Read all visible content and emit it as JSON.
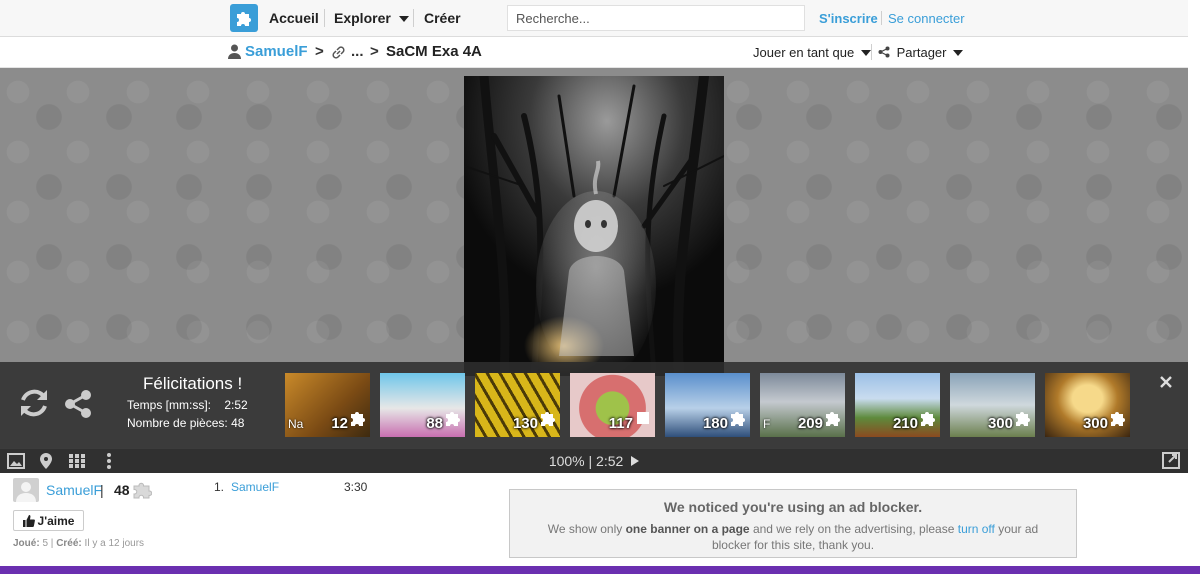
{
  "nav": {
    "home": "Accueil",
    "explore": "Explorer",
    "create": "Créer",
    "search_placeholder": "Recherche...",
    "signup": "S'inscrire",
    "login": "Se connecter"
  },
  "breadcrumb": {
    "user": "SamuelF",
    "sep1": ">",
    "ellipsis": "...",
    "sep2": ">",
    "title": "SaCM Exa 4A"
  },
  "actions": {
    "play_as": "Jouer en tant que",
    "share": "Partager"
  },
  "congrats": {
    "title": "Félicitations !",
    "time_label": "Temps [mm:ss]:",
    "time_value": "2:52",
    "pieces_label": "Nombre de pièces:",
    "pieces_value": "48"
  },
  "suggestions": [
    {
      "count": "12",
      "prefix": "Na"
    },
    {
      "count": "88",
      "prefix": ""
    },
    {
      "count": "130",
      "prefix": ""
    },
    {
      "count": "117",
      "prefix": ""
    },
    {
      "count": "180",
      "prefix": ""
    },
    {
      "count": "209",
      "prefix": "F"
    },
    {
      "count": "210",
      "prefix": ""
    },
    {
      "count": "300",
      "prefix": ""
    },
    {
      "count": "300",
      "prefix": ""
    }
  ],
  "status_bar": {
    "text": "100% | 2:52"
  },
  "info": {
    "author": "SamuelF",
    "sep": "|",
    "pieces": "48",
    "like": "J'aime",
    "played_label": "Joué:",
    "played_value": "5",
    "created_label": "Créé:",
    "created_value": "Il y a 12 jours"
  },
  "leaderboard": [
    {
      "rank": "1.",
      "name": "SamuelF",
      "time": "3:30"
    }
  ],
  "adblock": {
    "title": "We noticed you're using an ad blocker.",
    "text1": "We show only ",
    "bold": "one banner on a page",
    "text2": " and we rely on the advertising, please ",
    "link": "turn off",
    "text3": " your ad blocker for this site, thank you."
  },
  "colors": {
    "accent": "#3a9ed8",
    "overlay": "#2c2c2c",
    "taskbar": "#6b2fb0"
  }
}
